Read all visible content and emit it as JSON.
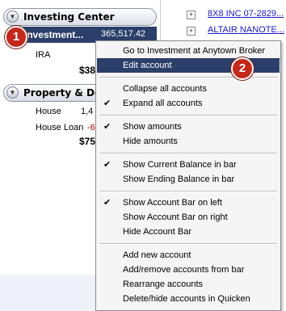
{
  "account_bar": {
    "groups": [
      {
        "label": "Investing Center"
      },
      {
        "label": "Property & Debt"
      }
    ],
    "selected_account": {
      "name": "Investment...",
      "amount": "365,517.42"
    },
    "ira": {
      "name": "IRA",
      "total": "$38"
    },
    "property": {
      "house": {
        "name": "House",
        "amount": "1,4"
      },
      "house_loan": {
        "name": "House Loan",
        "amount": "-6"
      },
      "total": "$75"
    }
  },
  "register": {
    "rows": [
      {
        "link": "8X8 INC 07-2829..."
      },
      {
        "link": "ALTAIR NANOTE..."
      }
    ]
  },
  "badges": {
    "one": "1",
    "two": "2"
  },
  "context_menu": {
    "items": [
      {
        "label": "Go to Investment at Anytown Broker",
        "checked": false
      },
      {
        "label": "Edit account",
        "checked": false,
        "highlighted": true
      },
      {
        "label": "Collapse all accounts",
        "checked": false
      },
      {
        "label": "Expand all accounts",
        "checked": true
      },
      {
        "label": "Show amounts",
        "checked": true
      },
      {
        "label": "Hide amounts",
        "checked": false
      },
      {
        "label": "Show Current Balance in bar",
        "checked": true
      },
      {
        "label": "Show Ending Balance in bar",
        "checked": false
      },
      {
        "label": "Show Account Bar on left",
        "checked": true
      },
      {
        "label": "Show Account Bar on right",
        "checked": false
      },
      {
        "label": "Hide Account Bar",
        "checked": false
      },
      {
        "label": "Add new account",
        "checked": false
      },
      {
        "label": "Add/remove accounts from bar",
        "checked": false
      },
      {
        "label": "Rearrange accounts",
        "checked": false
      },
      {
        "label": "Delete/hide accounts in Quicken",
        "checked": false
      }
    ],
    "check_glyph": "✔"
  },
  "colors": {
    "selection": "#2c3f6a",
    "badge": "#c4271b",
    "link": "#1a1ac8",
    "negative": "#c00000"
  }
}
